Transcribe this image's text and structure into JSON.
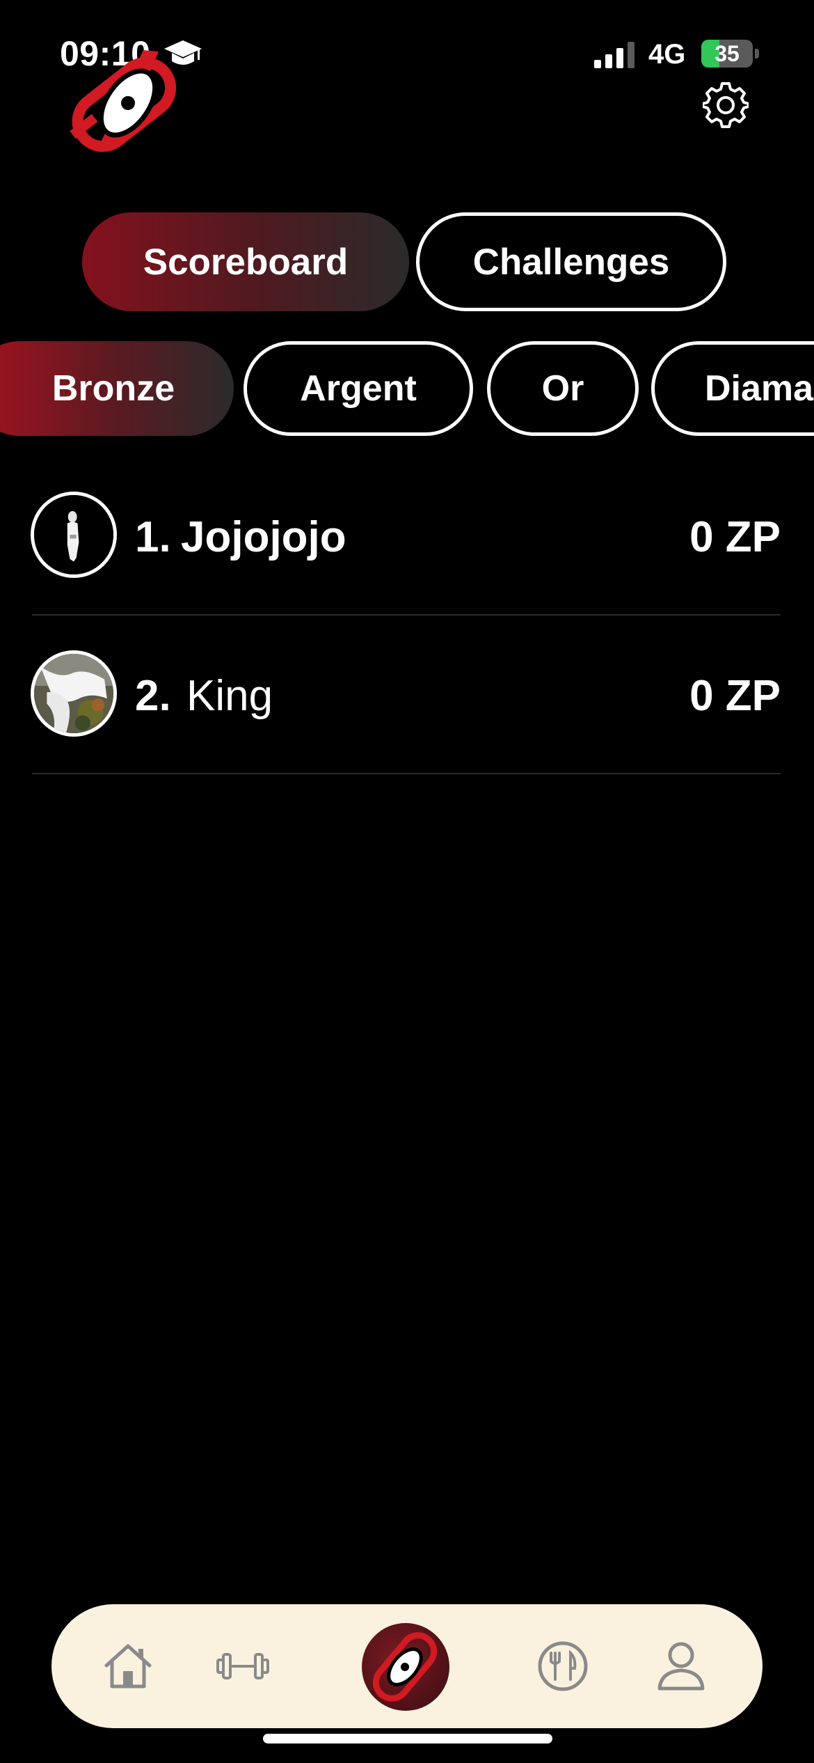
{
  "status_bar": {
    "time": "09:10",
    "network": "4G",
    "battery_percent": "35",
    "battery_level": 0.35
  },
  "segmented": {
    "active": "Scoreboard",
    "items": [
      {
        "label": "Scoreboard"
      },
      {
        "label": "Challenges"
      }
    ]
  },
  "leagues": {
    "active": "Bronze",
    "items": [
      {
        "label": "Bronze"
      },
      {
        "label": "Argent"
      },
      {
        "label": "Or"
      },
      {
        "label": "Diama"
      }
    ]
  },
  "scoreboard": {
    "rows": [
      {
        "rank": "1.",
        "name": "Jojojojo",
        "score": "0 ZP"
      },
      {
        "rank": "2.",
        "name": "King",
        "score": "0 ZP"
      }
    ]
  },
  "colors": {
    "accent": "#b5121b",
    "tabbar_bg": "#faf2df",
    "icon_gray": "#8a8a8a"
  },
  "tabbar": {
    "items": [
      {
        "icon": "home-icon"
      },
      {
        "icon": "dumbbell-icon"
      },
      {
        "icon": "app-logo-icon"
      },
      {
        "icon": "fork-knife-icon"
      },
      {
        "icon": "profile-icon"
      }
    ]
  }
}
